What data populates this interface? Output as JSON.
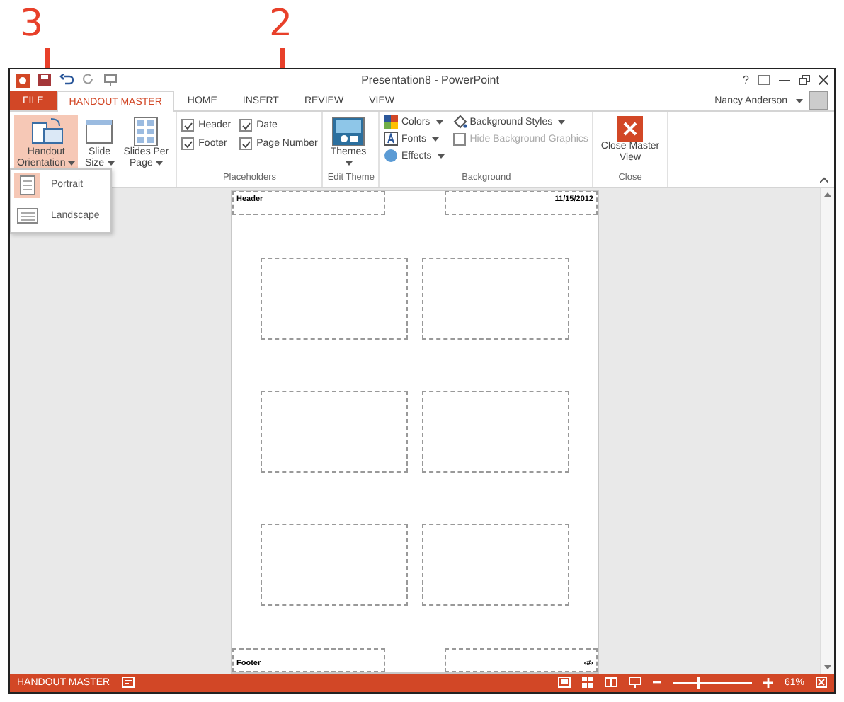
{
  "callouts": [
    {
      "number": "3"
    },
    {
      "number": "2"
    }
  ],
  "window": {
    "title": "Presentation8 - PowerPoint",
    "help": "?"
  },
  "tabs": [
    {
      "label": "FILE",
      "kind": "file",
      "selected": false
    },
    {
      "label": "HANDOUT MASTER",
      "kind": "tab",
      "selected": true
    },
    {
      "label": "HOME",
      "kind": "tab",
      "selected": false
    },
    {
      "label": "INSERT",
      "kind": "tab",
      "selected": false
    },
    {
      "label": "REVIEW",
      "kind": "tab",
      "selected": false
    },
    {
      "label": "VIEW",
      "kind": "tab",
      "selected": false
    }
  ],
  "user": {
    "name": "Nancy Anderson"
  },
  "ribbon": {
    "groups": [
      {
        "items": [
          {
            "kind": "big",
            "label": "Handout Orientation",
            "selected": true
          },
          {
            "kind": "big",
            "label": "Slide Size",
            "selected": false
          },
          {
            "kind": "big",
            "label": "Slides Per Page",
            "selected": false
          }
        ]
      },
      {
        "label": "Placeholders",
        "items": [
          {
            "kind": "check",
            "label": "Header",
            "checked": true
          },
          {
            "kind": "check",
            "label": "Date",
            "checked": true
          },
          {
            "kind": "check",
            "label": "Footer",
            "checked": true
          },
          {
            "kind": "check",
            "label": "Page Number",
            "checked": true
          }
        ]
      },
      {
        "label": "Edit Theme",
        "items": [
          {
            "kind": "big",
            "label": "Themes",
            "selected": false
          }
        ]
      },
      {
        "label": "Background",
        "items": [
          {
            "kind": "small",
            "label": "Colors"
          },
          {
            "kind": "small",
            "label": "Fonts"
          },
          {
            "kind": "small",
            "label": "Effects"
          },
          {
            "kind": "small",
            "label": "Background Styles"
          },
          {
            "kind": "check",
            "label": "Hide Background Graphics",
            "checked": false,
            "disabled": true
          }
        ]
      },
      {
        "label": "Close",
        "items": [
          {
            "kind": "big",
            "label": "Close Master View",
            "selected": false
          }
        ]
      }
    ]
  },
  "orientation_menu": [
    {
      "label": "Portrait",
      "selected": true
    },
    {
      "label": "Landscape",
      "selected": false
    }
  ],
  "handout": {
    "header": "Header",
    "date": "11/15/2012",
    "footer": "Footer",
    "page_number": "‹#›"
  },
  "status_bar": {
    "label": "HANDOUT MASTER",
    "zoom": "61%",
    "zoom_slider": {
      "level": 0.3
    }
  }
}
